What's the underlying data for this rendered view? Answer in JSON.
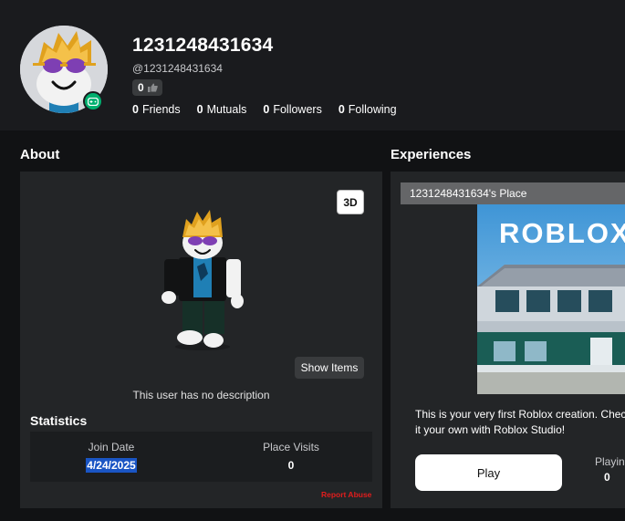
{
  "profile": {
    "display_name": "1231248431634",
    "username": "@1231248431634",
    "vote_count": "0",
    "stats": [
      {
        "count": "0",
        "label": "Friends"
      },
      {
        "count": "0",
        "label": "Mutuals"
      },
      {
        "count": "0",
        "label": "Followers"
      },
      {
        "count": "0",
        "label": "Following"
      }
    ]
  },
  "about": {
    "title": "About",
    "btn_3d": "3D",
    "show_items": "Show Items",
    "no_description": "This user has no description",
    "statistics_title": "Statistics",
    "join_date_label": "Join Date",
    "join_date_value": "4/24/2025",
    "place_visits_label": "Place Visits",
    "place_visits_value": "0",
    "report_abuse": "Report Abuse"
  },
  "experiences": {
    "title": "Experiences",
    "place_name": "1231248431634's Place",
    "thumbnail_logo": "ROBLOX",
    "description_line1": "This is your very first Roblox creation. Chec",
    "description_line2": "it your own with Roblox Studio!",
    "play_label": "Play",
    "playing_label": "Playin",
    "playing_value": "0"
  },
  "colors": {
    "background": "#111214",
    "card": "#232527",
    "presence_green": "#00b06f",
    "report_red": "#e11d1d",
    "selection_blue": "#1a55c4"
  }
}
